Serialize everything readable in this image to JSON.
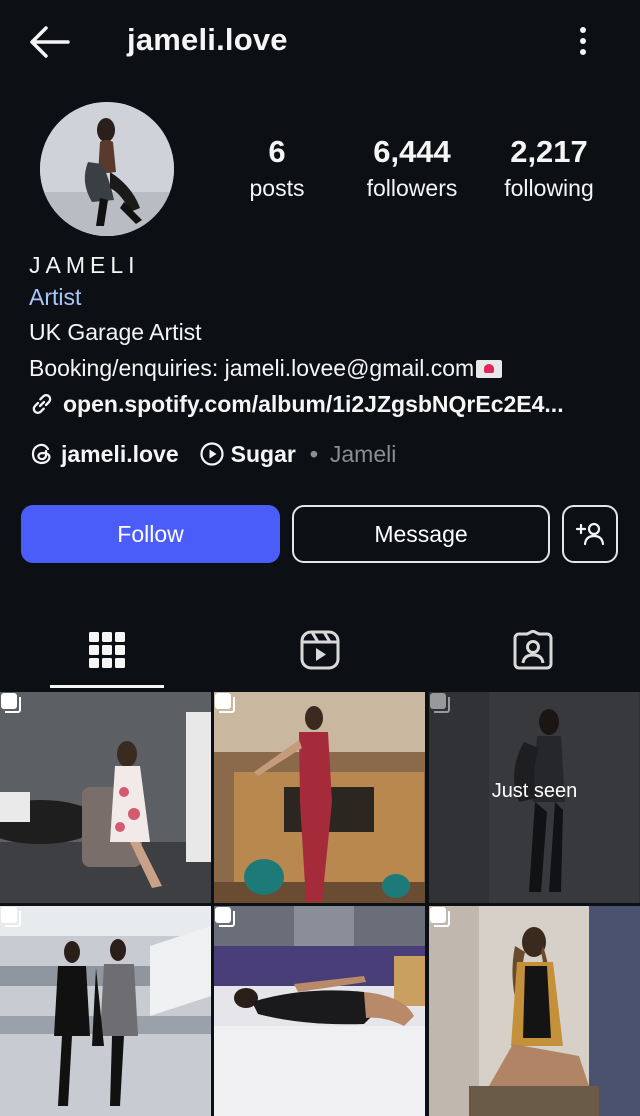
{
  "header": {
    "username": "jameli.love"
  },
  "stats": {
    "posts": {
      "value": "6",
      "label": "posts"
    },
    "followers": {
      "value": "6,444",
      "label": "followers"
    },
    "following": {
      "value": "2,217",
      "label": "following"
    }
  },
  "bio": {
    "display_name": "JAMELI",
    "category": "Artist",
    "line1": "UK Garage Artist",
    "line2": "Booking/enquiries:  jameli.lovee@gmail.com",
    "link": "open.spotify.com/album/1i2JZgsbNQrEc2E4..."
  },
  "chips": {
    "threads": "jameli.love",
    "music_title": "Sugar",
    "music_sep": "•",
    "music_artist": "Jameli"
  },
  "actions": {
    "follow": "Follow",
    "message": "Message"
  },
  "grid": {
    "overlay_text": "Just seen"
  },
  "colors": {
    "background": "#0c1014",
    "follow_button": "#4a5df9",
    "category_text": "#a8c7fa"
  },
  "icons": {
    "back": "arrow-left-icon",
    "more": "more-vertical-icon",
    "link": "link-icon",
    "threads": "threads-icon",
    "music": "play-circle-icon",
    "suggest": "add-person-icon",
    "grid_tab": "grid-icon",
    "reels_tab": "reels-icon",
    "tagged_tab": "tagged-icon",
    "multi_post": "carousel-icon"
  }
}
